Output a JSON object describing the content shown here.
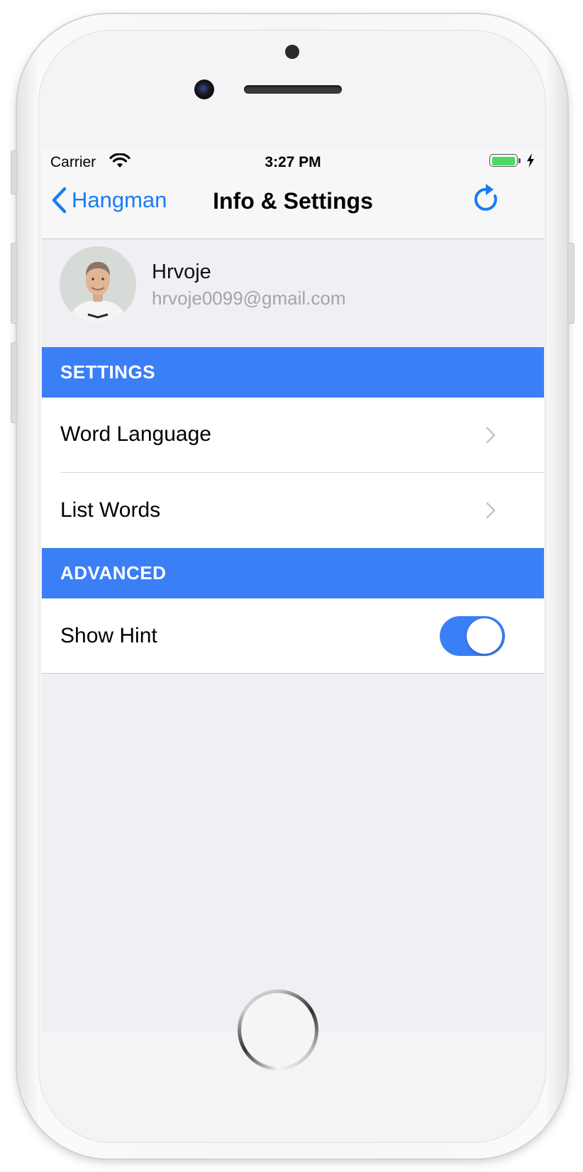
{
  "status_bar": {
    "carrier": "Carrier",
    "time": "3:27 PM",
    "battery_level": 1.0,
    "charging": true
  },
  "nav": {
    "back_label": "Hangman",
    "title": "Info & Settings",
    "right_icon": "refresh-icon"
  },
  "profile": {
    "name": "Hrvoje",
    "email": "hrvoje0099@gmail.com"
  },
  "sections": {
    "settings": {
      "title": "SETTINGS",
      "rows": [
        {
          "label": "Word Language",
          "accessory": "chevron-right-icon"
        },
        {
          "label": "List Words",
          "accessory": "chevron-right-icon"
        }
      ]
    },
    "advanced": {
      "title": "ADVANCED",
      "rows": [
        {
          "label": "Show Hint",
          "toggle_on": true
        }
      ]
    }
  },
  "colors": {
    "accent": "#1a7cf4",
    "section_header": "#3b7ff6",
    "background": "#efeff4",
    "battery": "#4cd964"
  }
}
